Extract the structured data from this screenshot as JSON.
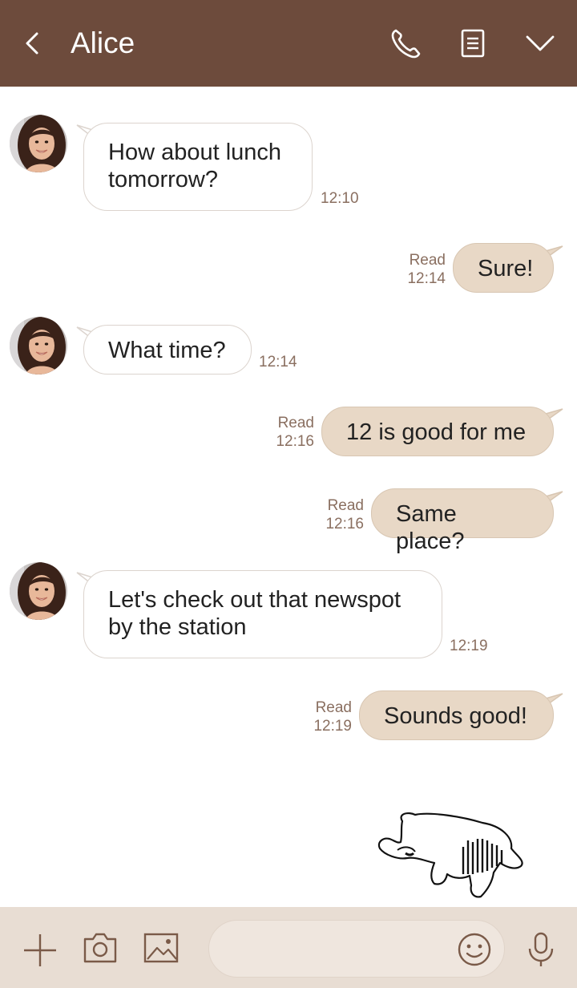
{
  "header": {
    "title": "Alice",
    "bg_color": "#6d4b3c",
    "icons": [
      "back-arrow-icon",
      "phone-icon",
      "notes-icon",
      "chevron-down-icon"
    ]
  },
  "messages": [
    {
      "from": "Alice",
      "direction": "incoming",
      "text_line1": "How about lunch",
      "text_line2": "tomorrow?",
      "time": "12:10"
    },
    {
      "from": "me",
      "direction": "outgoing",
      "text": "Sure!",
      "status": "Read",
      "time": "12:14"
    },
    {
      "from": "Alice",
      "direction": "incoming",
      "text": "What time?",
      "time": "12:14"
    },
    {
      "from": "me",
      "direction": "outgoing",
      "text": "12 is good for me",
      "status": "Read",
      "time": "12:16"
    },
    {
      "from": "me",
      "direction": "outgoing",
      "text": "Same place?",
      "status": "Read",
      "time": "12:16"
    },
    {
      "from": "Alice",
      "direction": "incoming",
      "text_line1": "Let's check out that newspot",
      "text_line2": "by the station",
      "time": "12:19"
    },
    {
      "from": "me",
      "direction": "outgoing",
      "text": "Sounds good!",
      "status": "Read",
      "time": "12:19"
    }
  ],
  "sticker": {
    "icon": "sleepy-animal-sticker"
  },
  "input_bar": {
    "bg_color": "#e8ddd3",
    "icons": [
      "plus-icon",
      "camera-icon",
      "image-icon",
      "emoji-icon",
      "microphone-icon"
    ],
    "message_value": ""
  },
  "colors": {
    "outgoing_bubble": "#e8d8c6",
    "incoming_bubble": "#ffffff",
    "meta_text": "#8a6f60"
  }
}
